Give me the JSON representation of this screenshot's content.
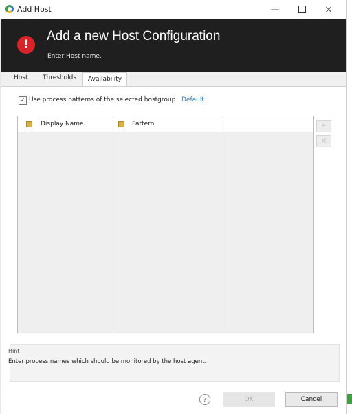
{
  "window": {
    "title": "Add Host",
    "controls": {
      "minimize": "—",
      "close": "×"
    }
  },
  "header": {
    "icon_glyph": "!",
    "title": "Add a new Host Configuration",
    "subtitle": "Enter Host name."
  },
  "tabs": [
    {
      "label": "Host",
      "active": false
    },
    {
      "label": "Thresholds",
      "active": false
    },
    {
      "label": "Availability",
      "active": true
    }
  ],
  "availability": {
    "use_patterns_checked": true,
    "check_glyph": "✓",
    "use_patterns_label": "Use process patterns of the selected hostgroup",
    "default_link": "Default",
    "table": {
      "columns": [
        "Display Name",
        "Pattern"
      ],
      "rows": []
    },
    "side_buttons": {
      "add": "+",
      "remove": "×"
    }
  },
  "hint": {
    "title": "Hint",
    "text": "Enter process names which should be monitored by the host agent."
  },
  "footer": {
    "help": "?",
    "ok": "OK",
    "cancel": "Cancel"
  },
  "colors": {
    "header_bg": "#1f1f1f",
    "error_icon": "#d9232a",
    "link": "#2a7fd1",
    "accent_green": "#3aa23a"
  }
}
